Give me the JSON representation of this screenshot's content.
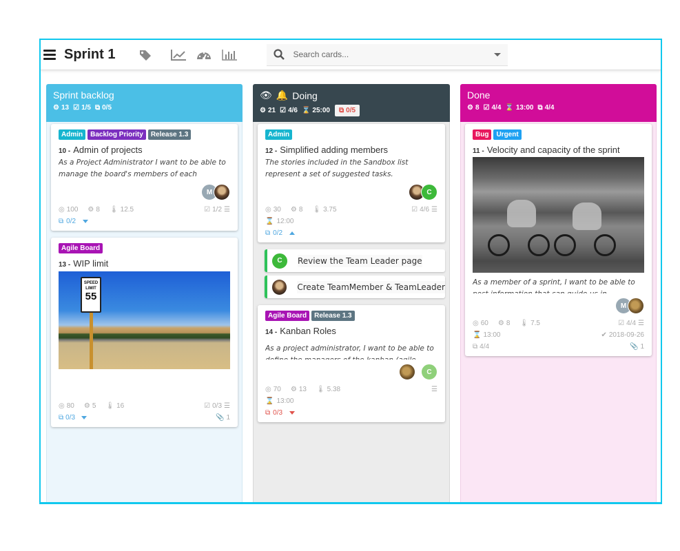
{
  "app": {
    "title": "Sprint 1",
    "toolbar_icons": [
      "tag-icon",
      "line-chart-icon",
      "dashboard-gauge-icon",
      "bar-chart-icon"
    ],
    "search": {
      "placeholder": "Search cards...",
      "value": ""
    }
  },
  "colors": {
    "accent": "#10c8ee",
    "backlog": "#4bbfe6",
    "doing": "#37474f",
    "done": "#d10d99",
    "subtask_green": "#2ec25a",
    "wip_red": "#e0524b"
  },
  "columns": [
    {
      "name": "Sprint backlog",
      "stats": {
        "effort": "13",
        "checklist": "1/5",
        "subtasks": "0/5"
      },
      "cards": [
        {
          "tags": [
            {
              "label": "Admin",
              "color": "#17b5cf"
            },
            {
              "label": "Backlog Priority",
              "color": "#7b2fbf"
            },
            {
              "label": "Release 1.3",
              "color": "#5d7582"
            }
          ],
          "number": "10 -",
          "title": "Admin of projects",
          "description": "As a Project Administrator  I want to be able to manage the board's members of each",
          "avatars": [
            {
              "initial": "M",
              "color": "#98a8b3"
            },
            {
              "initial": "",
              "photo": true
            }
          ],
          "points": "100",
          "effort": "8",
          "temp": "12.5",
          "checklist": "1/2",
          "subtasks": "0/2"
        },
        {
          "tags": [
            {
              "label": "Agile Board",
              "color": "#a814b4"
            }
          ],
          "number": "13 -",
          "title": "WIP limit",
          "image": "speed-limit-sign-photo",
          "image_text": {
            "line1": "SPEED",
            "line2": "LIMIT",
            "num": "55"
          },
          "points": "80",
          "effort": "5",
          "temp": "16",
          "checklist": "0/3",
          "subtasks": "0/3",
          "attachments": "1"
        }
      ]
    },
    {
      "name": "Doing",
      "stats": {
        "effort": "21",
        "checklist": "4/6",
        "time": "25:00",
        "subtasks": "0/5"
      },
      "cards": [
        {
          "tags": [
            {
              "label": "Admin",
              "color": "#17b5cf"
            }
          ],
          "number": "12 -",
          "title": "Simplified adding members",
          "description": "The stories included in the Sandbox list represent a set of suggested tasks.",
          "avatars": [
            {
              "initial": "",
              "photo": true
            },
            {
              "initial": "C",
              "color": "#3db93a"
            }
          ],
          "points": "30",
          "effort": "8",
          "temp": "3.75",
          "checklist": "4/6",
          "time": "12:00",
          "subtasks": "0/2",
          "subtask_items": [
            {
              "avatar": "C",
              "text": "Review the Team Leader page"
            },
            {
              "avatar": "",
              "text": "Create TeamMember & TeamLeader"
            }
          ]
        },
        {
          "tags": [
            {
              "label": "Agile Board",
              "color": "#a814b4"
            },
            {
              "label": "Release 1.3",
              "color": "#5d7582"
            }
          ],
          "number": "14 -",
          "title": "Kanban Roles",
          "description": "As a project administrator, I want to be able to define the managers of the kanban (agile",
          "avatars": [
            {
              "initial": "",
              "photo": true
            },
            {
              "initial": "C",
              "color": "#8fd07a"
            }
          ],
          "points": "70",
          "effort": "13",
          "temp": "5.38",
          "time": "13:00",
          "subtasks": "0/3"
        }
      ]
    },
    {
      "name": "Done",
      "stats": {
        "effort": "8",
        "checklist": "4/4",
        "time": "13:00",
        "subtasks": "4/4"
      },
      "cards": [
        {
          "tags": [
            {
              "label": "Bug",
              "color": "#e8175d"
            },
            {
              "label": "Urgent",
              "color": "#1ea1f2"
            }
          ],
          "number": "11 -",
          "title": "Velocity and capacity of the sprint",
          "image": "cyclists-motion-blur-photo",
          "description": "As a member of a sprint, I want to be able to post information that can guide us in",
          "avatars": [
            {
              "initial": "M",
              "color": "#98a8b3"
            },
            {
              "initial": "",
              "photo": true
            }
          ],
          "points": "60",
          "effort": "8",
          "temp": "7.5",
          "checklist": "4/4",
          "time": "13:00",
          "done_date": "2018-09-26",
          "subtasks": "4/4",
          "attachments": "1"
        }
      ]
    }
  ]
}
